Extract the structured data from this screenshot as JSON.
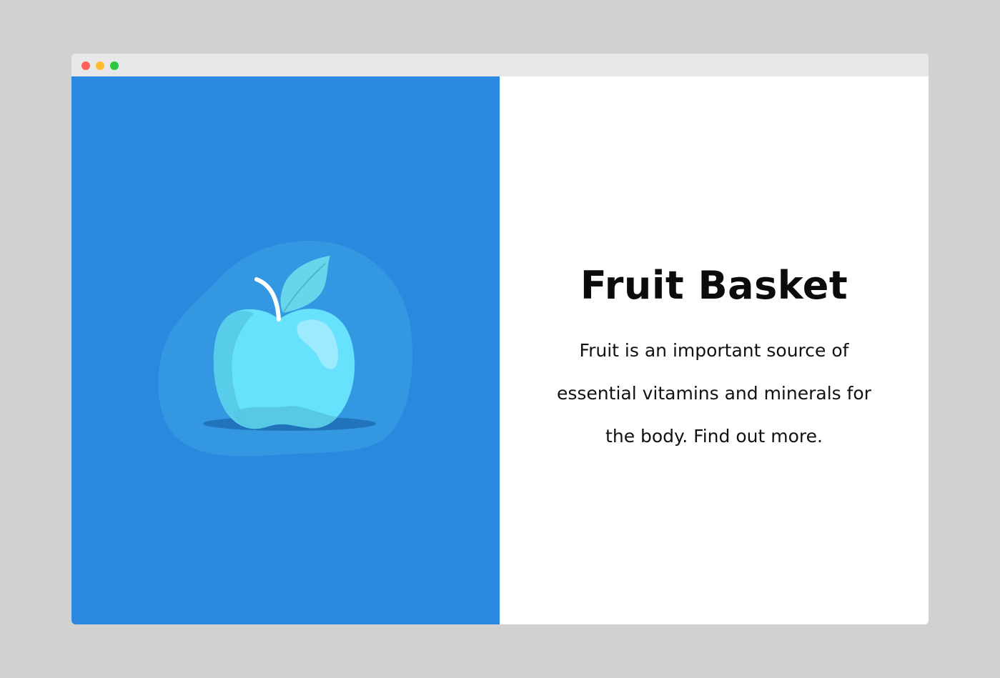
{
  "page": {
    "background_color": "#d1d1d1"
  },
  "window": {
    "controls": [
      {
        "name": "close",
        "color": "#fe5f57"
      },
      {
        "name": "minimize",
        "color": "#febc2e"
      },
      {
        "name": "maximize",
        "color": "#28c840"
      }
    ],
    "title_bar_color": "#e8e8e8"
  },
  "hero": {
    "illustration_icon": "apple-icon",
    "left_panel_color": "#2a89de",
    "apple_color": "#67e2fc",
    "title": "Fruit Basket",
    "description": "Fruit is an important source of essential vitamins and minerals for the body. Find out more."
  }
}
